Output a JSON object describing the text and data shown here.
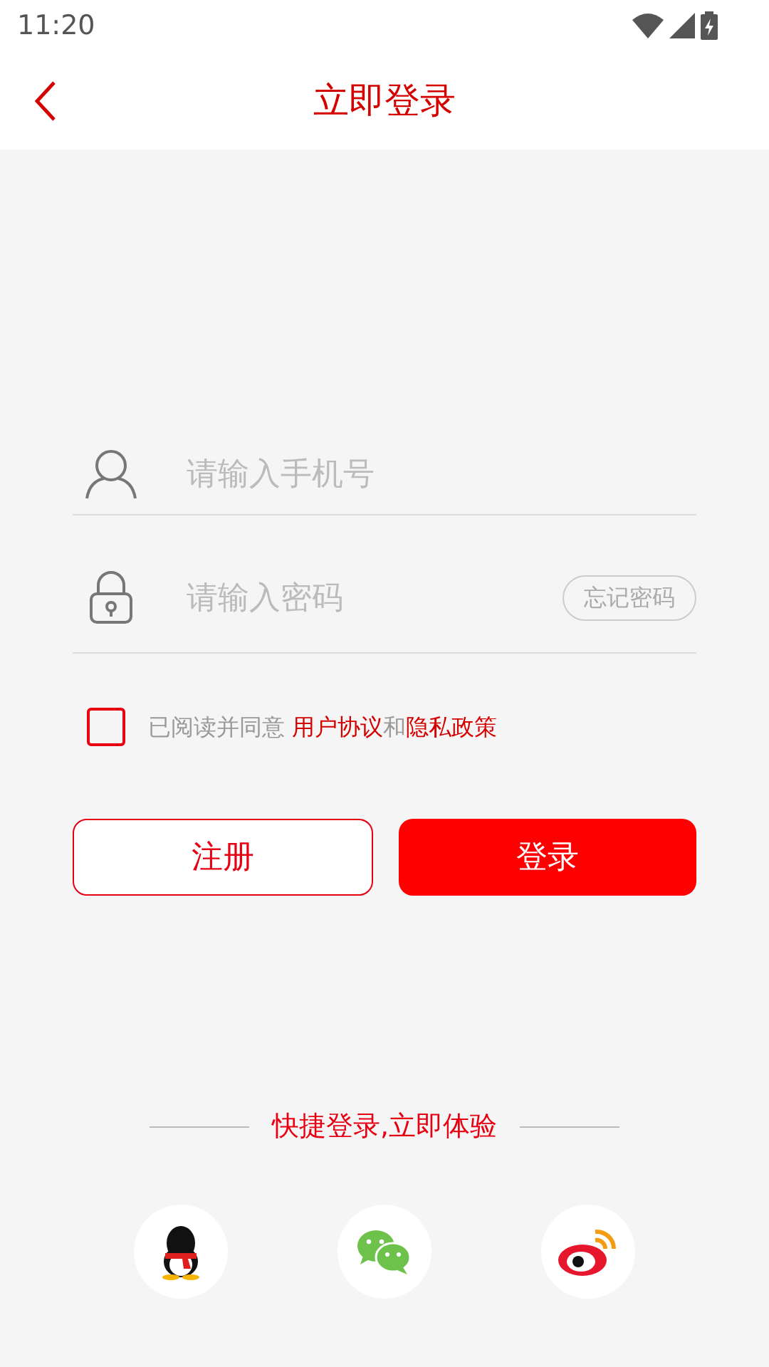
{
  "status_bar": {
    "time": "11:20"
  },
  "header": {
    "title": "立即登录"
  },
  "fields": [
    {
      "kind": "phone",
      "placeholder": "请输入手机号"
    },
    {
      "kind": "password",
      "placeholder": "请输入密码",
      "action": "忘记密码"
    }
  ],
  "agreement": {
    "checked": false,
    "parts": [
      {
        "kind": "text",
        "text": "已阅读并同意 "
      },
      {
        "kind": "link",
        "text": "用户协议"
      },
      {
        "kind": "text",
        "text": "和"
      },
      {
        "kind": "link",
        "text": "隐私政策"
      }
    ]
  },
  "buttons": [
    {
      "kind": "outline",
      "label": "注册"
    },
    {
      "kind": "primary",
      "label": "登录"
    }
  ],
  "quick_login": {
    "title": "快捷登录,立即体验",
    "providers": [
      {
        "kind": "qq"
      },
      {
        "kind": "wechat"
      },
      {
        "kind": "weibo"
      }
    ]
  }
}
